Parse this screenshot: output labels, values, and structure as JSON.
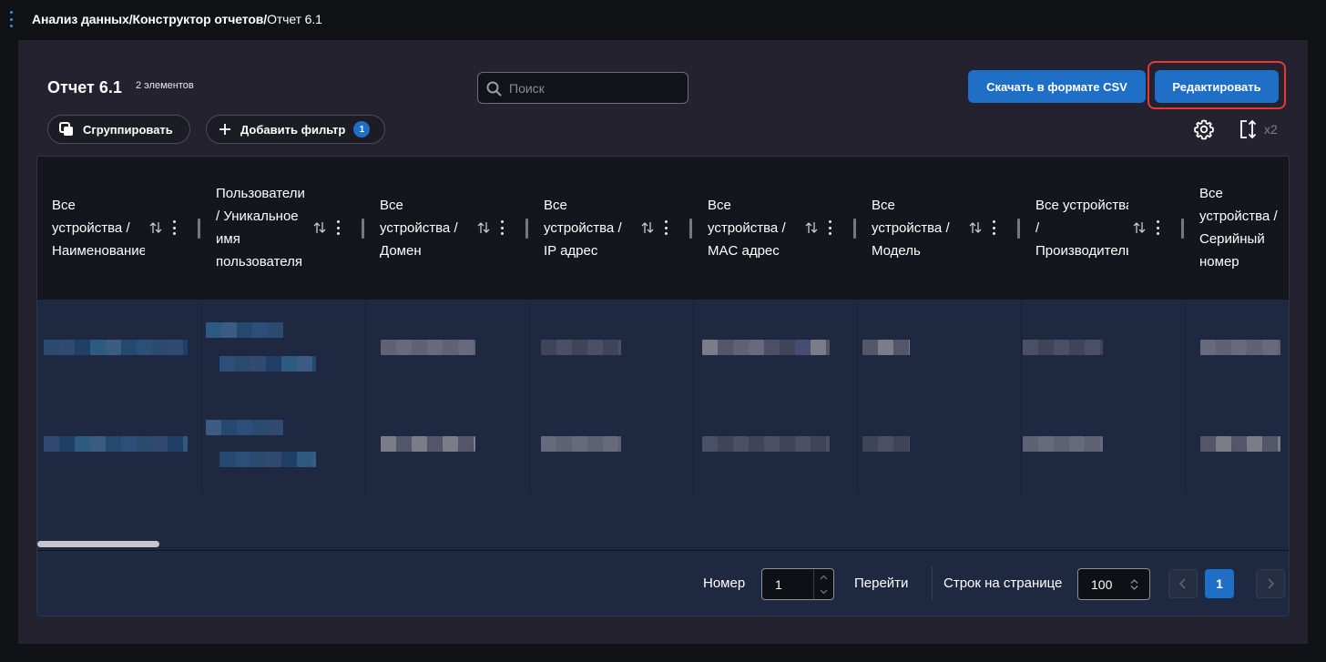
{
  "breadcrumb": {
    "part1": "Анализ данных/",
    "part2": "Конструктор отчетов/",
    "current": "Отчет 6.1"
  },
  "report": {
    "title": "Отчет 6.1",
    "count": "2 элементов"
  },
  "search": {
    "placeholder": "Поиск"
  },
  "actions": {
    "csv": "Скачать в формате CSV",
    "edit": "Редактировать"
  },
  "toolbar": {
    "group": "Сгруппировать",
    "add_filter": "Добавить фильтр",
    "filter_count": "1",
    "density": "x2"
  },
  "columns": [
    {
      "lines": [
        "Все",
        "устройства /",
        "Наименование"
      ]
    },
    {
      "lines": [
        "Пользователи",
        "/ Уникальное",
        "имя",
        "пользователя"
      ]
    },
    {
      "lines": [
        "Все",
        "устройства /",
        "Домен"
      ]
    },
    {
      "lines": [
        "Все",
        "устройства /",
        "IP адрес"
      ]
    },
    {
      "lines": [
        "Все",
        "устройства /",
        "MAC адрес"
      ]
    },
    {
      "lines": [
        "Все",
        "устройства /",
        "Модель"
      ]
    },
    {
      "lines": [
        "Все устройства",
        "/",
        "Производитель"
      ]
    },
    {
      "lines": [
        "Все",
        "устройства /",
        "Серийный",
        "номер"
      ]
    }
  ],
  "pagination": {
    "page_label": "Номер",
    "page_value": "1",
    "go_label": "Перейти",
    "rows_label": "Строк на странице",
    "rows_value": "100",
    "current_page": "1"
  },
  "colors": {
    "accent": "#1f6fc7",
    "highlight": "#e53935"
  }
}
